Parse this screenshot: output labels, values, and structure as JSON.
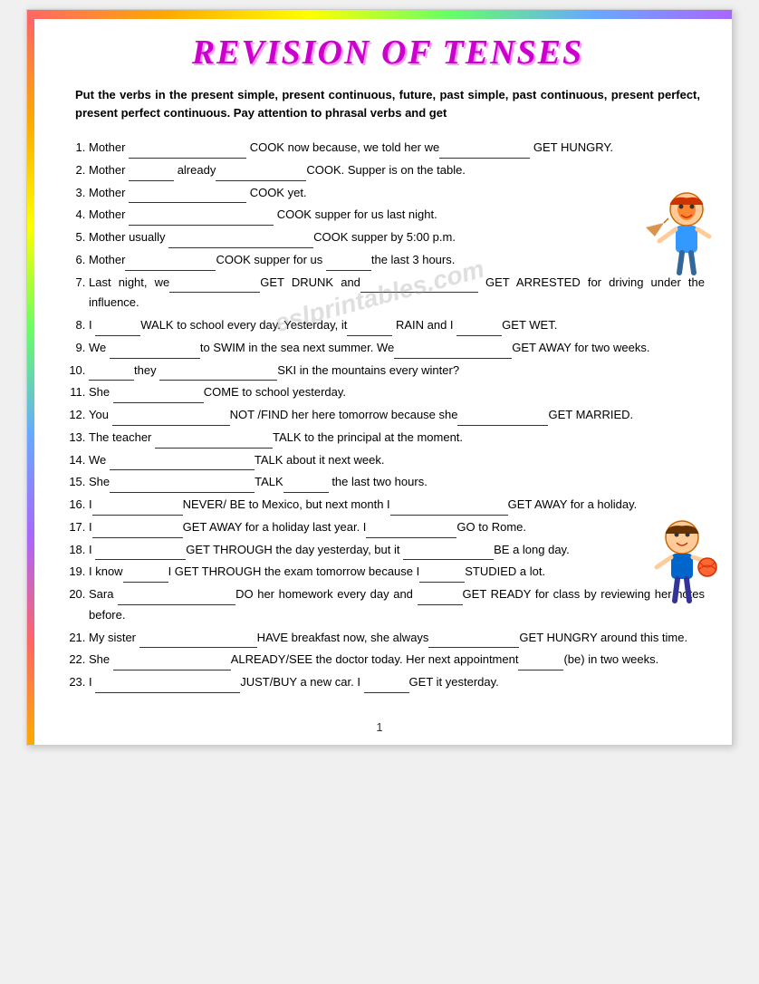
{
  "page": {
    "title": "REVISION OF TENSES",
    "instructions": "Put the verbs in the present simple, present continuous, future, past simple, past continuous, present perfect, present perfect continuous.  Pay attention to phrasal verbs and get",
    "footer_page": "1",
    "exercises": [
      {
        "num": 1,
        "text": "Mother ",
        "blank1": "lg",
        "text2": " COOK now because, we told her we",
        "blank2": "md",
        "text3": " GET HUNGRY."
      },
      {
        "num": 2,
        "text": "Mother ",
        "blank1": "sm",
        "text2": " already",
        "blank2": "md",
        "text3": " COOK. Supper is  on the table."
      },
      {
        "num": 3,
        "text": "Mother ",
        "blank1": "lg",
        "text2": " COOK yet."
      },
      {
        "num": 4,
        "text": "Mother ",
        "blank1": "xl",
        "text2": " COOK supper for us last night."
      },
      {
        "num": 5,
        "text": "Mother usually ",
        "blank1": "xl",
        "text2": " COOK supper by 5:00 p.m."
      },
      {
        "num": 6,
        "text": "Mother",
        "blank1": "md",
        "text2": " COOK supper for us ",
        "blank2": "sm",
        "text3": " the last 3 hours."
      },
      {
        "num": 7,
        "text": "Last night, we",
        "blank1": "md",
        "text2": " GET DRUNK and",
        "blank2": "lg",
        "text3": " GET ARRESTED for driving under the influence."
      },
      {
        "num": 8,
        "text": "I ",
        "blank1": "sm",
        "text2": " WALK to school every day.  Yesterday, it",
        "blank2": "sm",
        "text3": " RAIN and I ",
        "blank3": "sm",
        "text4": " GET WET."
      },
      {
        "num": 9,
        "text": "We ",
        "blank1": "md",
        "text2": " to SWIM in the sea next summer. We",
        "blank2": "lg",
        "text3": " GET AWAY for two weeks."
      },
      {
        "num": 10,
        "text": "",
        "blank1": "sm",
        "text2": " they ",
        "blank2": "lg",
        "text3": " SKI in the mountains every winter?"
      },
      {
        "num": 11,
        "text": "She ",
        "blank1": "md",
        "text2": " COME to school yesterday."
      },
      {
        "num": 12,
        "text": "You ",
        "blank1": "lg",
        "text2": " NOT /FIND her here tomorrow because she",
        "blank2": "md",
        "text3": " GET MARRIED."
      },
      {
        "num": 13,
        "text": "The teacher ",
        "blank1": "lg",
        "text2": " TALK to the principal at the moment."
      },
      {
        "num": 14,
        "text": "We ",
        "blank1": "xl",
        "text2": " TALK about it next week."
      },
      {
        "num": 15,
        "text": "She",
        "blank1": "xl",
        "text2": " TALK",
        "blank2": "sm",
        "text3": " the last two hours."
      },
      {
        "num": 16,
        "text": "I",
        "blank1": "md",
        "text2": " NEVER/ BE to Mexico, but next month I",
        "blank2": "lg",
        "text3": " GET AWAY for a holiday."
      },
      {
        "num": 17,
        "text": "I",
        "blank1": "md",
        "text2": " GET AWAY for a holiday last year.  I",
        "blank2": "md",
        "text3": " GO to Rome."
      },
      {
        "num": 18,
        "text": "I ",
        "blank1": "md",
        "text2": " GET THROUGH the day yesterday, but it ",
        "blank2": "md",
        "text3": " BE a long day."
      },
      {
        "num": 19,
        "text": "I  know",
        "blank1": "sm",
        "text2": " I GET THROUGH the exam tomorrow because I",
        "blank2": "sm",
        "text3": " STUDIED a lot."
      },
      {
        "num": 20,
        "text": "Sara ",
        "blank1": "lg",
        "text2": " DO her homework every day and ",
        "blank2": "sm",
        "text3": " GET READY for class by reviewing her notes before."
      },
      {
        "num": 21,
        "text": "My  sister ",
        "blank1": "lg",
        "text2": " HAVE breakfast now, she always",
        "blank2": "md",
        "text3": " GET HUNGRY around this time."
      },
      {
        "num": 22,
        "text": "She ",
        "blank1": "lg",
        "text2": " ALREADY/SEE  the  doctor  today.   Her  next appointment",
        "blank2": "sm",
        "text3": " (be) in two weeks."
      },
      {
        "num": 23,
        "text": "I ",
        "blank1": "xl",
        "text2": " JUST/BUY  a new car.  I ",
        "blank2": "sm",
        "text3": " GET it yesterday."
      }
    ]
  }
}
